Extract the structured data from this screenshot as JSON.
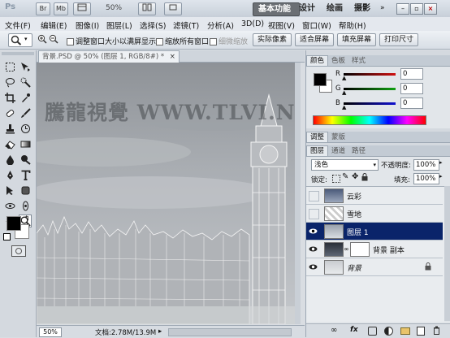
{
  "app": {
    "logo": "Ps",
    "title_buttons": [
      "Br",
      "Mb"
    ],
    "zoom_select": "50%",
    "workspaces": [
      "基本功能",
      "设计",
      "绘画",
      "摄影"
    ],
    "window_controls": [
      "minimize-icon",
      "restore-icon",
      "close-icon"
    ]
  },
  "menu": [
    "文件(F)",
    "编辑(E)",
    "图像(I)",
    "图层(L)",
    "选择(S)",
    "滤镜(T)",
    "分析(A)",
    "3D(D)",
    "视图(V)",
    "窗口(W)",
    "帮助(H)"
  ],
  "options": {
    "check1": "调整窗口大小以满屏显示",
    "check2": "缩放所有窗口",
    "check3": "细微缩放",
    "btn_actual": "实际像素",
    "btn_fit": "适合屏幕",
    "btn_fill": "填充屏幕",
    "btn_print": "打印尺寸"
  },
  "document": {
    "tab_title": "背景.PSD @ 50% (图层 1, RGB/8#) *",
    "close": "×",
    "watermark": "騰龍視覺 WWW.TLVI.NET",
    "zoom": "50%",
    "doc_info": "文档:2.78M/13.9M"
  },
  "color_panel": {
    "tabs": [
      "颜色",
      "色板",
      "样式"
    ],
    "labels": [
      "R",
      "G",
      "B"
    ],
    "values": [
      "0",
      "0",
      "0"
    ],
    "colors": {
      "r": "#d01010",
      "g": "#10a010",
      "b": "#1010d0"
    }
  },
  "adjust_panel": {
    "tabs": [
      "调整",
      "蒙版"
    ]
  },
  "layers_panel": {
    "tabs": [
      "图层",
      "通道",
      "路径"
    ],
    "blend_mode": "浅色",
    "opacity_label": "不透明度:",
    "opacity_value": "100%",
    "lock_label": "锁定:",
    "fill_label": "填充:",
    "fill_value": "100%",
    "layers": [
      {
        "name": "云彩",
        "visible": false,
        "selected": false
      },
      {
        "name": "雪地",
        "visible": false,
        "selected": false
      },
      {
        "name": "图层 1",
        "visible": true,
        "selected": true
      },
      {
        "name": "背景 副本",
        "visible": true,
        "selected": false
      },
      {
        "name": "背景",
        "visible": true,
        "selected": false
      }
    ],
    "bottom_icons": [
      "link-icon",
      "fx-icon",
      "mask-icon",
      "adjustment-icon",
      "group-icon",
      "new-layer-icon",
      "trash-icon"
    ]
  }
}
